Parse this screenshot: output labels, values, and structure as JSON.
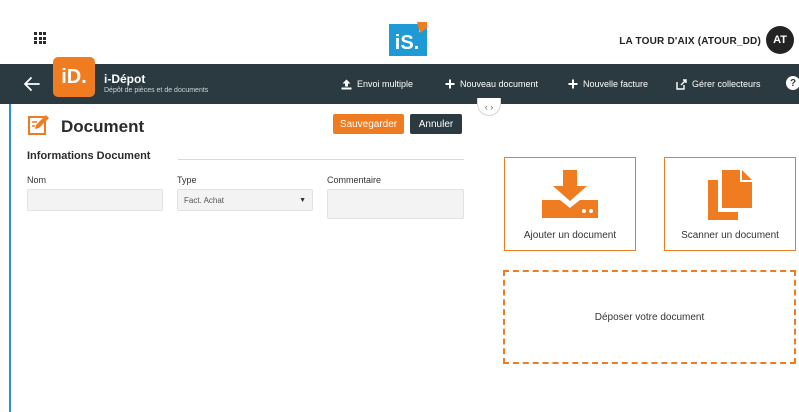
{
  "header": {
    "logo_text": "iS.",
    "user_name": "LA TOUR D'AIX (ATOUR_DD)",
    "avatar_initials": "AT"
  },
  "appbar": {
    "badge_text": "iD.",
    "title": "i-Dépot",
    "subtitle": "Dépôt de pièces et de documents",
    "actions": [
      {
        "label": "Envoi multiple",
        "icon": "upload-icon"
      },
      {
        "label": "Nouveau document",
        "icon": "plus-icon"
      },
      {
        "label": "Nouvelle facture",
        "icon": "plus-icon"
      },
      {
        "label": "Gérer collecteurs",
        "icon": "external-edit-icon"
      }
    ],
    "help_symbol": "?"
  },
  "collapse_handle": "‹ ›",
  "document": {
    "title": "Document",
    "save_label": "Sauvegarder",
    "cancel_label": "Annuler",
    "section_title": "Informations Document",
    "fields": {
      "name": {
        "label": "Nom",
        "value": ""
      },
      "type": {
        "label": "Type",
        "value": "Fact. Achat"
      },
      "comment": {
        "label": "Commentaire",
        "value": ""
      }
    }
  },
  "panel": {
    "add_document_label": "Ajouter un document",
    "scan_document_label": "Scanner un document",
    "dropzone_label": "Déposer votre document"
  },
  "colors": {
    "accent": "#f07c22",
    "appbar": "#2a3a40",
    "brand_blue": "#2e8fd6"
  }
}
